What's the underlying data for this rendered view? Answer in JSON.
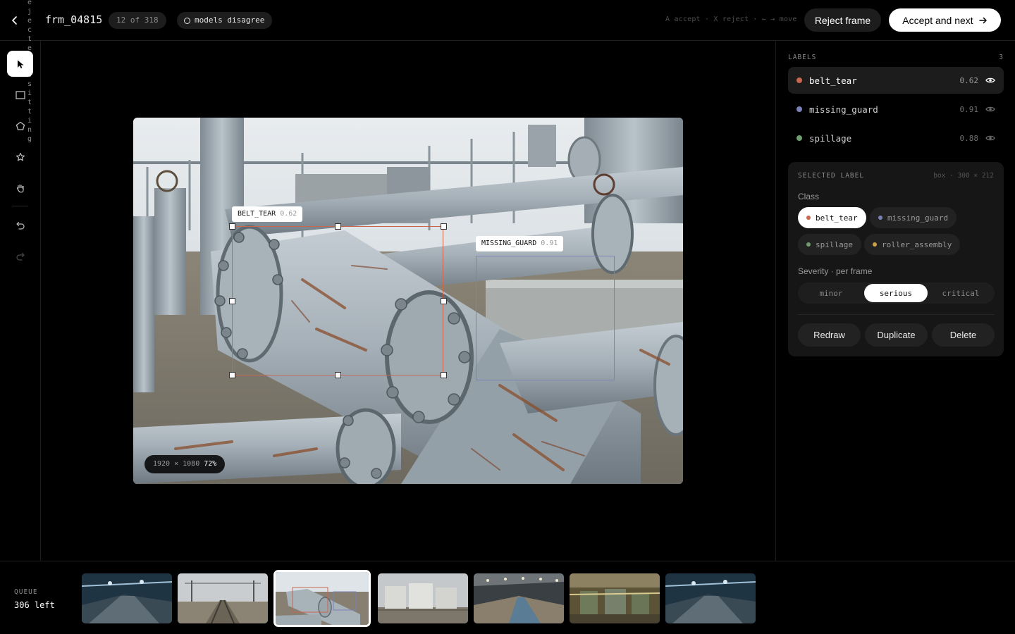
{
  "header": {
    "frame_id": "frm_04815",
    "counter": "12 of 318",
    "status_badge": "models disagree",
    "shortcuts": "A accept · X reject · ← → move",
    "reject_label": "Reject frame",
    "accept_label": "Accept and next",
    "vertical_caption": "ejectenissitting"
  },
  "image": {
    "resolution": "1920 × 1080",
    "zoom": "72%"
  },
  "boxes": [
    {
      "label": "BELT_TEAR",
      "confidence": "0.62",
      "color": "#c8674f"
    },
    {
      "label": "MISSING_GUARD",
      "confidence": "0.91",
      "color": "#7b82b8"
    }
  ],
  "labels_panel": {
    "title": "LABELS",
    "count": "3",
    "items": [
      {
        "name": "belt_tear",
        "confidence": "0.62",
        "color": "#c8674f"
      },
      {
        "name": "missing_guard",
        "confidence": "0.91",
        "color": "#7b82b8"
      },
      {
        "name": "spillage",
        "confidence": "0.88",
        "color": "#6f9c70"
      }
    ]
  },
  "selected": {
    "title": "SELECTED LABEL",
    "dims": "box · 300 × 212",
    "class_label": "Class",
    "classes": [
      {
        "name": "belt_tear",
        "color": "#c8674f"
      },
      {
        "name": "missing_guard",
        "color": "#7b82b8"
      },
      {
        "name": "spillage",
        "color": "#6f9c70"
      },
      {
        "name": "roller_assembly",
        "color": "#c9a24a"
      }
    ],
    "severity_label": "Severity · per frame",
    "severity_options": [
      "minor",
      "serious",
      "critical"
    ],
    "severity_selected": "serious",
    "actions": [
      "Redraw",
      "Duplicate",
      "Delete"
    ]
  },
  "queue": {
    "title": "QUEUE",
    "remaining": "306 left"
  }
}
